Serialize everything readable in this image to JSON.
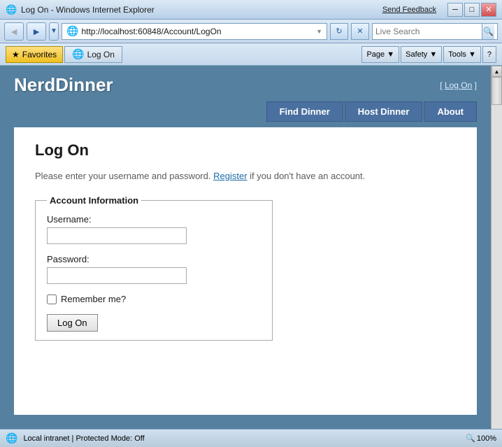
{
  "titlebar": {
    "title": "Log On - Windows Internet Explorer",
    "send_feedback": "Send Feedback",
    "min_btn": "─",
    "max_btn": "□",
    "close_btn": "✕"
  },
  "addressbar": {
    "url": "http://localhost:60848/Account/LogOn",
    "back_icon": "◄",
    "forward_icon": "►",
    "refresh_icon": "↻",
    "stop_icon": "✕",
    "live_search_placeholder": "Live Search",
    "search_icon": "🔍"
  },
  "toolbar": {
    "favorites_label": "Favorites",
    "favorites_icon": "★",
    "tab_icon": "🌐",
    "tab_label": "Log On",
    "page_btn": "Page ▼",
    "safety_btn": "Safety ▼",
    "tools_btn": "Tools ▼",
    "help_btn": "?"
  },
  "nerd_dinner": {
    "logo": "NerdDinner",
    "header_link_prefix": "[ ",
    "header_link": "Log On",
    "header_link_suffix": " ]",
    "nav_find": "Find Dinner",
    "nav_host": "Host Dinner",
    "nav_about": "About",
    "page_title": "Log On",
    "intro_text": "Please enter your username and password.",
    "intro_register_link": "Register",
    "intro_suffix": " if you don't have an account.",
    "fieldset_legend": "Account Information",
    "username_label": "Username:",
    "password_label": "Password:",
    "remember_label": "Remember me?",
    "submit_label": "Log On"
  },
  "statusbar": {
    "icon": "🌐",
    "text": "Local intranet | Protected Mode: Off",
    "zoom_icon": "🔍",
    "zoom_label": "100%"
  }
}
